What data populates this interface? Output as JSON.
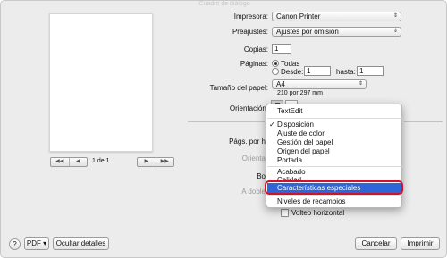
{
  "window": {
    "title": "Cuadro de diálogo"
  },
  "preview": {
    "page_text": "1 de 1",
    "nav_first": "◀◀",
    "nav_prev": "◀",
    "nav_next": "▶",
    "nav_last": "▶▶"
  },
  "printer": {
    "label": "Impresora:",
    "value": "Canon Printer"
  },
  "presets": {
    "label": "Preajustes:",
    "value": "Ajustes por omisión"
  },
  "copies": {
    "label": "Copias:",
    "value": "1"
  },
  "pages": {
    "label": "Páginas:",
    "all": "Todas",
    "from_label": "Desde:",
    "from_value": "1",
    "to_label": "hasta:",
    "to_value": "1"
  },
  "paper": {
    "label": "Tamaño del papel:",
    "value": "A4",
    "dims": "210 por 297 mm"
  },
  "orientation": {
    "label": "Orientación:"
  },
  "behind": {
    "pages_per_sheet": "Págs. por h",
    "orient_dim": "Orienta",
    "border": "Bo",
    "duplex": "A doble",
    "flip": "Volteo horizontal"
  },
  "menu": {
    "app_item": "TextEdit",
    "items_a": [
      "Disposición",
      "Ajuste de color",
      "Gestión del papel",
      "Origen del papel",
      "Portada"
    ],
    "items_b": [
      "Acabado",
      "Calidad"
    ],
    "highlighted": "Características especiales",
    "items_c": [
      "Niveles de recambios"
    ]
  },
  "buttons": {
    "help": "?",
    "pdf": "PDF",
    "pdf_arrow": "▾",
    "hide_details": "Ocultar detalles",
    "cancel": "Cancelar",
    "print": "Imprimir"
  }
}
